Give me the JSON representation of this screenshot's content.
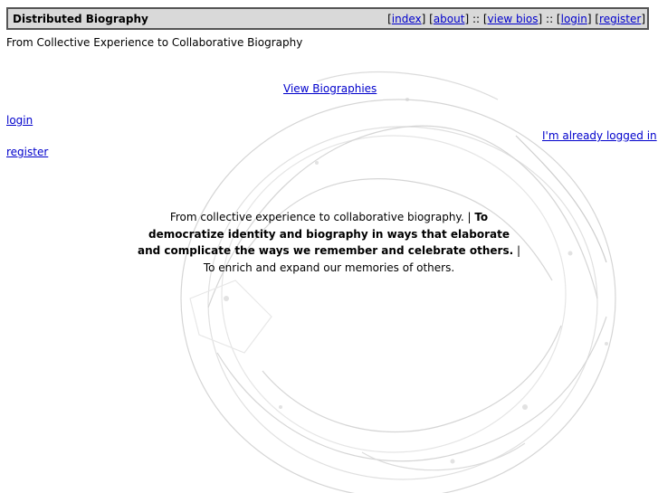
{
  "header": {
    "title": "Distributed Biography",
    "nav": {
      "index": "index",
      "about": "about",
      "view_bios": "view bios",
      "login": "login",
      "register": "register"
    }
  },
  "tagline": "From Collective Experience to Collaborative Biography",
  "links": {
    "view_biographies": "View Biographies",
    "login": "login",
    "already_logged_in": "I'm already logged in",
    "register": "register"
  },
  "mission": {
    "part1": "From collective experience to collaborative biography. |",
    "part2_bold": "To democratize identity and biography in ways that elaborate and complicate the ways we remember and celebrate others.",
    "part3": "| To enrich and expand our memories of others."
  },
  "colors": {
    "header_bg": "#d9d9d9",
    "header_border": "#555555",
    "link": "#0000cc"
  }
}
